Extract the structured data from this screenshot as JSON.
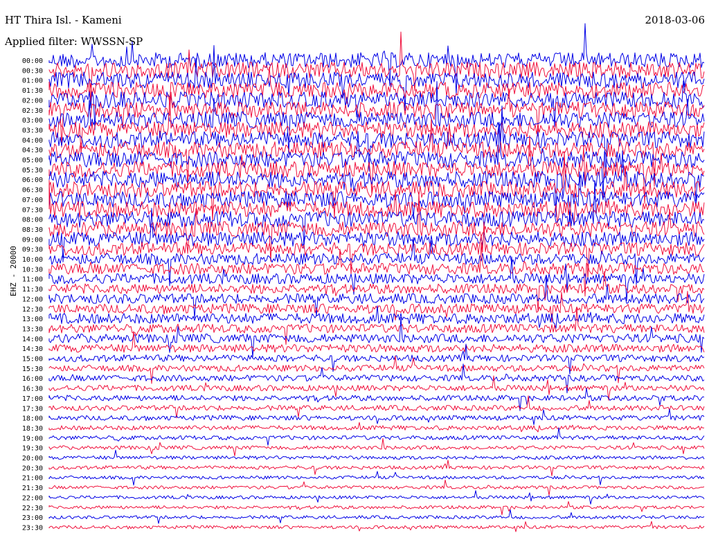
{
  "header": {
    "station": "HT Thira Isl. - Kameni",
    "filter": "Applied filter: WWSSN-SP",
    "date": "2018-03-06"
  },
  "chart_data": {
    "type": "line",
    "title": "HT Thira Isl. - Kameni",
    "subtitle": "Applied filter: WWSSN-SP",
    "date": "2018-03-06",
    "ylabel": "EHZ - 20000",
    "trace_interval_minutes": 30,
    "row_labels": [
      "00:00",
      "00:30",
      "01:00",
      "01:30",
      "02:00",
      "02:30",
      "03:00",
      "03:30",
      "04:00",
      "04:30",
      "05:00",
      "05:30",
      "06:00",
      "06:30",
      "07:00",
      "07:30",
      "08:00",
      "08:30",
      "09:00",
      "09:30",
      "10:00",
      "10:30",
      "11:00",
      "11:30",
      "12:00",
      "12:30",
      "13:00",
      "13:30",
      "14:00",
      "14:30",
      "15:00",
      "15:30",
      "16:00",
      "16:30",
      "17:00",
      "17:30",
      "18:00",
      "18:30",
      "19:00",
      "19:30",
      "20:00",
      "20:30",
      "21:00",
      "21:30",
      "22:00",
      "22:30",
      "23:00",
      "23:30"
    ],
    "trace_colors": [
      "#0000e6",
      "#f0103c"
    ],
    "relative_noise_amplitude": [
      0.95,
      1,
      1,
      1,
      1,
      1,
      1,
      1,
      1,
      1,
      1,
      1,
      1,
      1,
      1,
      1,
      1,
      0.95,
      0.9,
      0.8,
      0.7,
      0.7,
      0.65,
      0.6,
      0.62,
      0.6,
      0.65,
      0.55,
      0.55,
      0.5,
      0.42,
      0.4,
      0.38,
      0.36,
      0.34,
      0.32,
      0.3,
      0.28,
      0.26,
      0.24,
      0.22,
      0.22,
      0.2,
      0.2,
      0.2,
      0.2,
      0.2,
      0.2
    ],
    "grid": false,
    "legend": "none"
  }
}
